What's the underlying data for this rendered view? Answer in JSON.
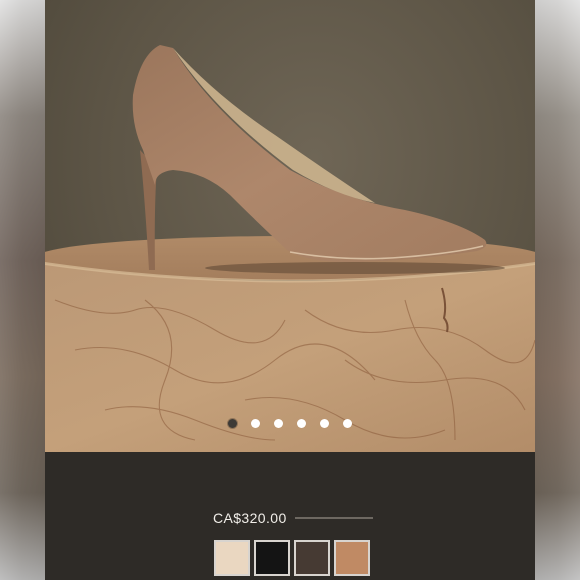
{
  "product": {
    "price": "CA$320.00"
  },
  "carousel": {
    "dots": 6,
    "active_index": 0
  },
  "swatches": [
    {
      "name": "swatch-nude",
      "color": "#ead7c1"
    },
    {
      "name": "swatch-black",
      "color": "#141414"
    },
    {
      "name": "swatch-dark-brown",
      "color": "#463a33"
    },
    {
      "name": "swatch-tan-suede",
      "color": "#c08a64"
    }
  ],
  "colors": {
    "panel_background": "#2e2b27",
    "backdrop": "#5d5546",
    "shoe": "#a88065",
    "pedestal": "#b99470"
  }
}
